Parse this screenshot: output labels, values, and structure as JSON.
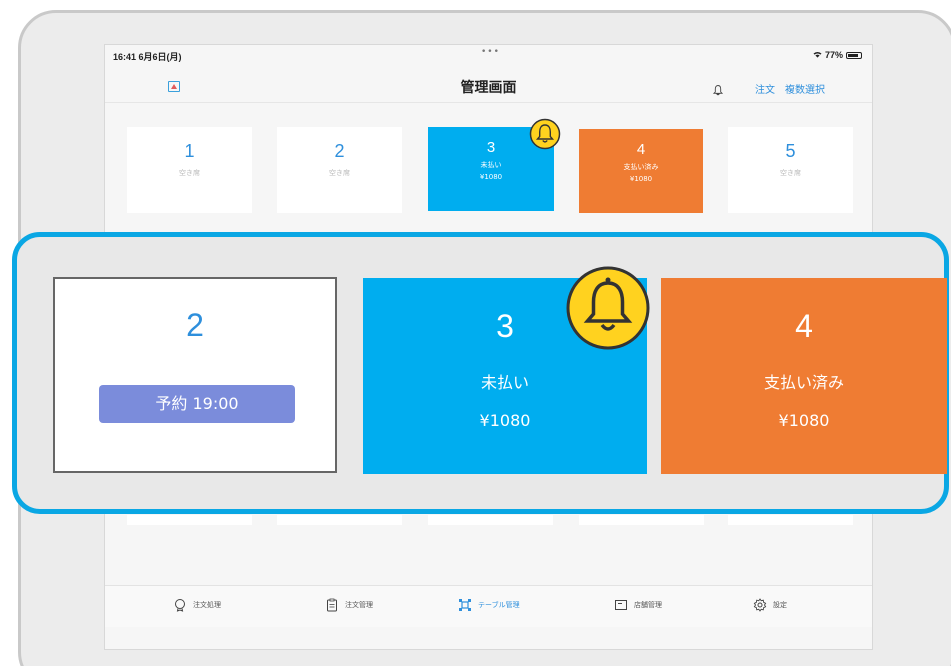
{
  "status_bar": {
    "time": "16:41  6月6日(月)",
    "dots": "•••",
    "battery": "77%"
  },
  "nav": {
    "title": "管理画面",
    "order_label": "注文",
    "multi_select_label": "複数選択"
  },
  "tables_small": [
    {
      "number": "1",
      "status": "空き席"
    },
    {
      "number": "2",
      "status": "空き席"
    },
    {
      "number": "3",
      "status": "未払い",
      "price": "¥1080"
    },
    {
      "number": "4",
      "status": "支払い済み",
      "price": "¥1080"
    },
    {
      "number": "5",
      "status": "空き席"
    }
  ],
  "zoom": {
    "table_2": {
      "number": "2",
      "reservation": "予約 19:00"
    },
    "table_3": {
      "number": "3",
      "status": "未払い",
      "price": "¥1080"
    },
    "table_4": {
      "number": "4",
      "status": "支払い済み",
      "price": "¥1080"
    }
  },
  "tabs": [
    {
      "label": "注文処理",
      "icon": "order-process-icon"
    },
    {
      "label": "注文管理",
      "icon": "clipboard-icon"
    },
    {
      "label": "テーブル管理",
      "icon": "table-icon"
    },
    {
      "label": "店舗管理",
      "icon": "store-icon"
    },
    {
      "label": "設定",
      "icon": "gear-icon"
    }
  ],
  "colors": {
    "accent_blue": "#2e8fdc",
    "unpaid_blue": "#00adef",
    "paid_orange": "#ef7c33",
    "reservation_purple": "#7b8cdb",
    "bell_yellow": "#ffd21f",
    "callout_border": "#0aa7e4"
  }
}
